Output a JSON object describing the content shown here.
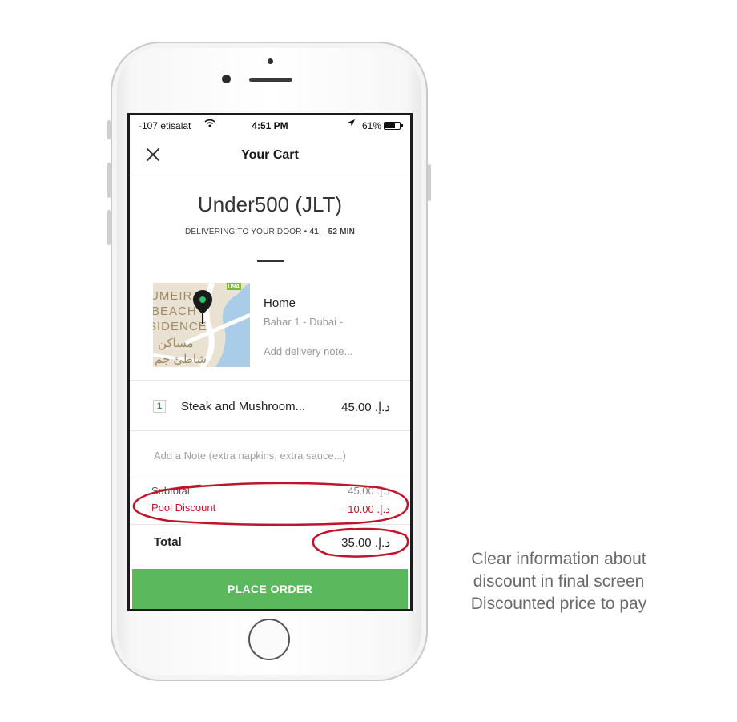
{
  "status_bar": {
    "carrier": "-107 etisalat",
    "time": "4:51 PM",
    "battery": "61%"
  },
  "nav": {
    "title": "Your Cart"
  },
  "restaurant": {
    "name": "Under500 (JLT)",
    "delivery_prefix": "DELIVERING TO YOUR DOOR •",
    "delivery_eta": "41 – 52 MIN"
  },
  "map": {
    "labels": [
      "UMEIRAH",
      "BEACH",
      "SIDENCE",
      "مساكن",
      "شاطئ جم"
    ],
    "road_badge": "D94"
  },
  "address": {
    "name": "Home",
    "line": "Bahar 1 - Dubai -",
    "note_placeholder": "Add delivery note..."
  },
  "items": [
    {
      "qty": "1",
      "name": "Steak and Mushroom...",
      "price": "45.00 .د.إ"
    }
  ],
  "note_placeholder": "Add a Note (extra napkins, extra sauce...)",
  "summary": {
    "subtotal_label": "Subtotal",
    "subtotal_value": "45.00 .د.إ",
    "discount_label": "Pool Discount",
    "discount_value": "-10.00 .د.إ",
    "total_label": "Total",
    "total_value": "35.00 .د.إ"
  },
  "place_order_label": "PLACE ORDER",
  "annotation": {
    "lines": [
      "Clear information about",
      "discount in final screen",
      "Discounted price to pay"
    ],
    "circle_color": "#c0142b"
  },
  "colors": {
    "accent_green": "#5cb85c",
    "discount_red": "#c0142b"
  }
}
